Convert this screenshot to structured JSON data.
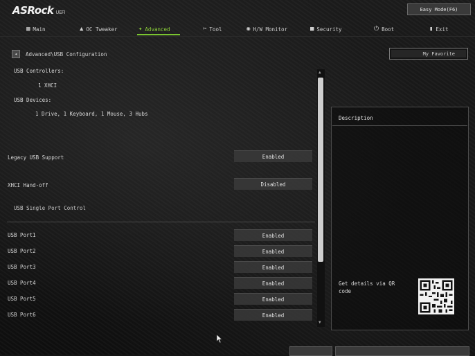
{
  "header": {
    "logo": "ASRock",
    "logo_suffix": "UEFI",
    "easy_mode": "Easy Mode(F6)"
  },
  "nav": [
    {
      "label": "Main",
      "icon": "grid-icon"
    },
    {
      "label": "OC Tweaker",
      "icon": "rocket-icon"
    },
    {
      "label": "Advanced",
      "icon": "star-icon",
      "active": true
    },
    {
      "label": "Tool",
      "icon": "tools-icon"
    },
    {
      "label": "H/W Monitor",
      "icon": "monitor-icon"
    },
    {
      "label": "Security",
      "icon": "shield-icon"
    },
    {
      "label": "Boot",
      "icon": "power-icon"
    },
    {
      "label": "Exit",
      "icon": "exit-icon"
    }
  ],
  "breadcrumb": "Advanced\\USB Configuration",
  "favorite": "My Favorite",
  "usb_info": {
    "controllers_label": "USB Controllers:",
    "controllers_value": "1 XHCI",
    "devices_label": "USB Devices:",
    "devices_value": "1 Drive, 1 Keyboard, 1 Mouse, 3 Hubs"
  },
  "options": [
    {
      "label": "Legacy USB Support",
      "value": "Enabled"
    },
    {
      "label": "XHCI Hand-off",
      "value": "Disabled"
    }
  ],
  "section_title": "USB Single Port Control",
  "ports": [
    {
      "label": "USB Port1",
      "value": "Enabled"
    },
    {
      "label": "USB Port2",
      "value": "Enabled"
    },
    {
      "label": "USB Port3",
      "value": "Enabled"
    },
    {
      "label": "USB Port4",
      "value": "Enabled"
    },
    {
      "label": "USB Port5",
      "value": "Enabled"
    },
    {
      "label": "USB Port6",
      "value": "Enabled"
    }
  ],
  "description": {
    "title": "Description",
    "qr_text": "Get details via QR code"
  },
  "colors": {
    "accent": "#8ed33a",
    "value_bg": "#3a3a3a"
  }
}
